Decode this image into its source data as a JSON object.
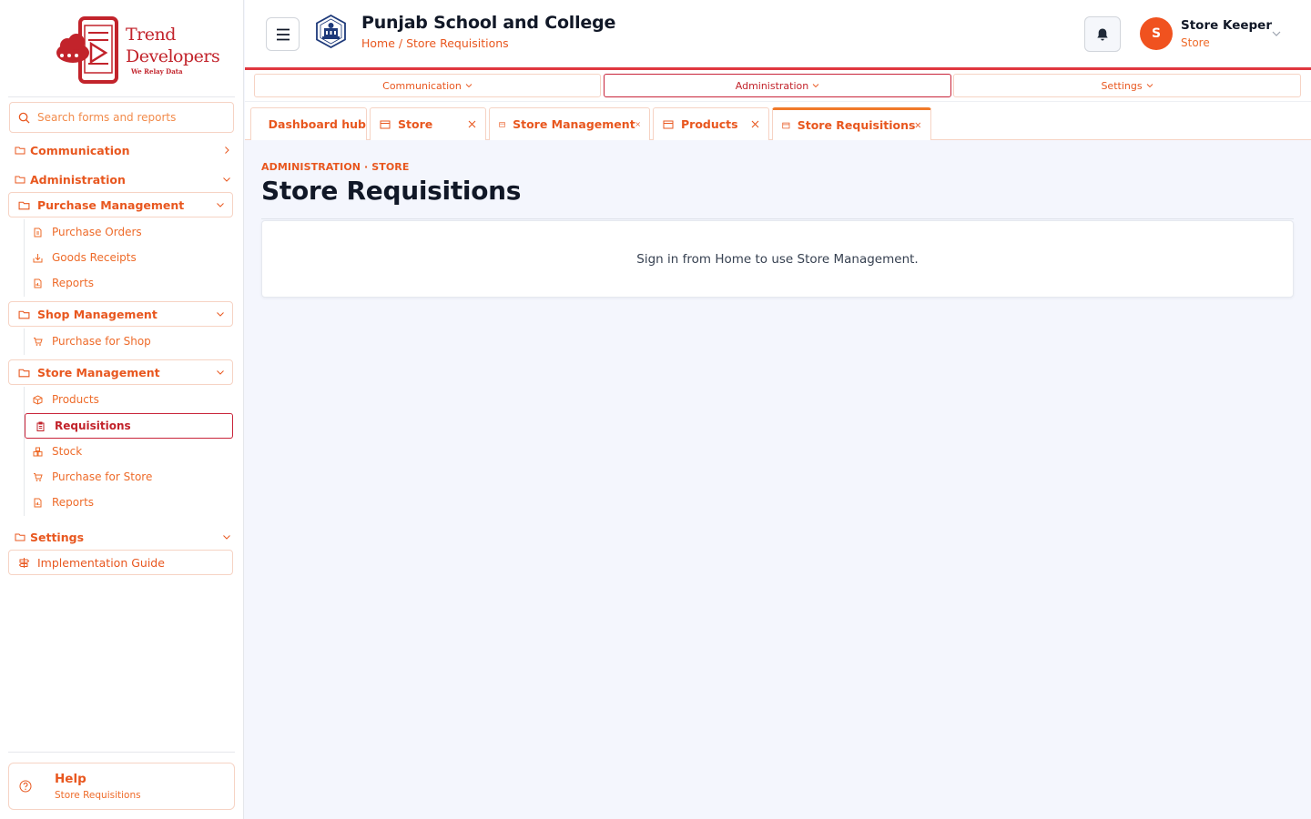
{
  "brand": {
    "line1": "Trend",
    "line2": "Developers",
    "tagline": "We Relay Data",
    "accent": "#e8571f",
    "brand_red": "#c2232b"
  },
  "sidebar": {
    "search_placeholder": "Search forms and reports",
    "groups": {
      "communication": "Communication",
      "administration": "Administration",
      "settings": "Settings"
    },
    "purchase": {
      "label": "Purchase Management",
      "items": [
        "Purchase Orders",
        "Goods Receipts",
        "Reports"
      ]
    },
    "shop": {
      "label": "Shop Management",
      "items": [
        "Purchase for Shop"
      ]
    },
    "store": {
      "label": "Store Management",
      "items": [
        "Products",
        "Requisitions",
        "Stock",
        "Purchase for Store",
        "Reports"
      ],
      "active_item": "Requisitions"
    },
    "implementation": "Implementation Guide",
    "help": {
      "title": "Help",
      "subtitle": "Store Requisitions"
    }
  },
  "header": {
    "school_name": "Punjab School and College",
    "breadcrumb": "Home / Store Requisitions",
    "user": {
      "initial": "S",
      "name": "Store Keeper",
      "role": "Store"
    }
  },
  "topnav": {
    "items": [
      "Communication",
      "Administration",
      "Settings"
    ],
    "active": "Administration"
  },
  "tabs": [
    {
      "label": "Dashboard hub",
      "icon": "home-icon",
      "closable": false
    },
    {
      "label": "Store",
      "icon": "window-icon",
      "closable": true
    },
    {
      "label": "Store Management",
      "icon": "window-icon",
      "closable": true
    },
    {
      "label": "Products",
      "icon": "window-icon",
      "closable": true
    },
    {
      "label": "Store Requisitions",
      "icon": "window-icon",
      "closable": true,
      "active": true
    }
  ],
  "main": {
    "kicker": "ADMINISTRATION · STORE",
    "title": "Store Requisitions",
    "message": "Sign in from Home to use Store Management."
  }
}
